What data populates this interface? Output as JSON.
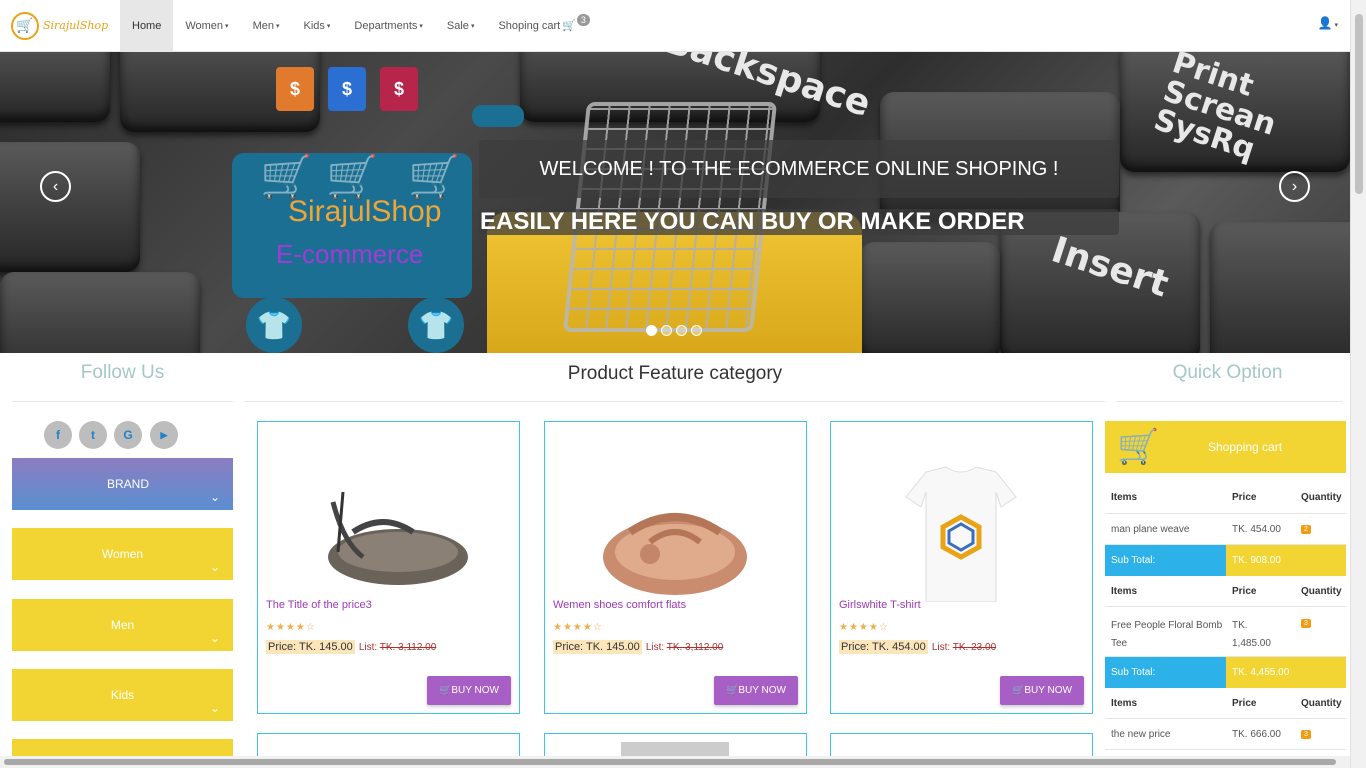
{
  "brand": {
    "logo_text": "SirajulShop"
  },
  "nav": {
    "items": [
      {
        "label": "Home",
        "active": true
      },
      {
        "label": "Women",
        "caret": "▾"
      },
      {
        "label": "Men",
        "caret": "▾"
      },
      {
        "label": "Kids",
        "caret": "▾"
      },
      {
        "label": "Departments",
        "caret": "▾"
      },
      {
        "label": "Sale",
        "caret": "▾"
      }
    ],
    "cart_label": "Shoping cart",
    "cart_count": "3",
    "user_icon": "user-icon"
  },
  "carousel": {
    "caption_1": "WELCOME ! TO THE ECOMMERCE ONLINE SHOPING !",
    "caption_2": "EASILY HERE YOU CAN BUY OR MAKE ORDER",
    "logo_name": "SirajulShop",
    "logo_sub": "E-commerce",
    "keys": [
      "Backspace",
      "Print Screan SysRq",
      "Insert"
    ],
    "prev_icon": "chevron-left-icon",
    "next_icon": "chevron-right-icon",
    "slides": 4,
    "active_slide": 1
  },
  "follow": {
    "title": "Follow Us",
    "social": [
      {
        "name": "facebook-icon",
        "glyph": "f"
      },
      {
        "name": "twitter-icon",
        "glyph": "t"
      },
      {
        "name": "google-icon",
        "glyph": "G"
      },
      {
        "name": "youtube-icon",
        "glyph": "▶"
      }
    ],
    "menu": [
      "BRAND",
      "Women",
      "Men",
      "Kids"
    ]
  },
  "products": {
    "title": "Product Feature category",
    "items": [
      {
        "title": "The Title of the price3",
        "stars": "★★★★☆",
        "price_label": "Price:",
        "price": "TK. 145.00",
        "list_label": "List:",
        "list": "TK. 3,112.00",
        "button": "BUY NOW"
      },
      {
        "title": "Wemen shoes comfort flats",
        "stars": "★★★★☆",
        "price_label": "Price:",
        "price": "TK. 145.00",
        "list_label": "List:",
        "list": "TK. 3,112.00",
        "button": "BUY NOW"
      },
      {
        "title": "Girlswhite T-shirt",
        "stars": "★★★★☆",
        "price_label": "Price:",
        "price": "TK. 454.00",
        "list_label": "List:",
        "list": "TK. 23.00",
        "button": "BUY NOW"
      }
    ]
  },
  "quick": {
    "title": "Quick Option",
    "cart_label": "Shopping cart",
    "col_items": "Items",
    "col_price": "Price",
    "col_qty": "Quantity",
    "sub_label": "Sub Total:",
    "orders": [
      {
        "item": "man plane weave",
        "price": "TK. 454.00",
        "qty": "2",
        "subtotal": "TK. 908.00"
      },
      {
        "item": "Free People Floral Bomb Tee",
        "price": "TK. 1,485.00",
        "qty": "3",
        "subtotal": "TK. 4,455.00"
      },
      {
        "item": "the new price",
        "price": "TK. 666.00",
        "qty": "3"
      }
    ]
  },
  "colors": {
    "accent_yellow": "#f2d533",
    "accent_purple": "#a75ec5",
    "accent_cyan": "#3dc6e8",
    "accent_blue": "#2cb2e8"
  }
}
